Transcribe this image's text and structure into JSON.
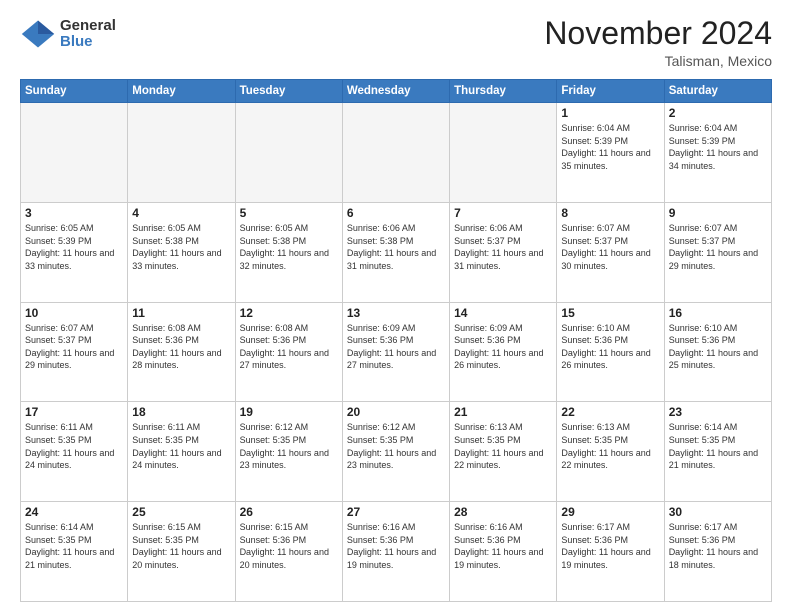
{
  "header": {
    "logo_general": "General",
    "logo_blue": "Blue",
    "month_title": "November 2024",
    "location": "Talisman, Mexico"
  },
  "days_of_week": [
    "Sunday",
    "Monday",
    "Tuesday",
    "Wednesday",
    "Thursday",
    "Friday",
    "Saturday"
  ],
  "weeks": [
    [
      {
        "day": "",
        "empty": true
      },
      {
        "day": "",
        "empty": true
      },
      {
        "day": "",
        "empty": true
      },
      {
        "day": "",
        "empty": true
      },
      {
        "day": "",
        "empty": true
      },
      {
        "day": "1",
        "sunrise": "6:04 AM",
        "sunset": "5:39 PM",
        "daylight": "11 hours and 35 minutes."
      },
      {
        "day": "2",
        "sunrise": "6:04 AM",
        "sunset": "5:39 PM",
        "daylight": "11 hours and 34 minutes."
      }
    ],
    [
      {
        "day": "3",
        "sunrise": "6:05 AM",
        "sunset": "5:39 PM",
        "daylight": "11 hours and 33 minutes."
      },
      {
        "day": "4",
        "sunrise": "6:05 AM",
        "sunset": "5:38 PM",
        "daylight": "11 hours and 33 minutes."
      },
      {
        "day": "5",
        "sunrise": "6:05 AM",
        "sunset": "5:38 PM",
        "daylight": "11 hours and 32 minutes."
      },
      {
        "day": "6",
        "sunrise": "6:06 AM",
        "sunset": "5:38 PM",
        "daylight": "11 hours and 31 minutes."
      },
      {
        "day": "7",
        "sunrise": "6:06 AM",
        "sunset": "5:37 PM",
        "daylight": "11 hours and 31 minutes."
      },
      {
        "day": "8",
        "sunrise": "6:07 AM",
        "sunset": "5:37 PM",
        "daylight": "11 hours and 30 minutes."
      },
      {
        "day": "9",
        "sunrise": "6:07 AM",
        "sunset": "5:37 PM",
        "daylight": "11 hours and 29 minutes."
      }
    ],
    [
      {
        "day": "10",
        "sunrise": "6:07 AM",
        "sunset": "5:37 PM",
        "daylight": "11 hours and 29 minutes."
      },
      {
        "day": "11",
        "sunrise": "6:08 AM",
        "sunset": "5:36 PM",
        "daylight": "11 hours and 28 minutes."
      },
      {
        "day": "12",
        "sunrise": "6:08 AM",
        "sunset": "5:36 PM",
        "daylight": "11 hours and 27 minutes."
      },
      {
        "day": "13",
        "sunrise": "6:09 AM",
        "sunset": "5:36 PM",
        "daylight": "11 hours and 27 minutes."
      },
      {
        "day": "14",
        "sunrise": "6:09 AM",
        "sunset": "5:36 PM",
        "daylight": "11 hours and 26 minutes."
      },
      {
        "day": "15",
        "sunrise": "6:10 AM",
        "sunset": "5:36 PM",
        "daylight": "11 hours and 26 minutes."
      },
      {
        "day": "16",
        "sunrise": "6:10 AM",
        "sunset": "5:36 PM",
        "daylight": "11 hours and 25 minutes."
      }
    ],
    [
      {
        "day": "17",
        "sunrise": "6:11 AM",
        "sunset": "5:35 PM",
        "daylight": "11 hours and 24 minutes."
      },
      {
        "day": "18",
        "sunrise": "6:11 AM",
        "sunset": "5:35 PM",
        "daylight": "11 hours and 24 minutes."
      },
      {
        "day": "19",
        "sunrise": "6:12 AM",
        "sunset": "5:35 PM",
        "daylight": "11 hours and 23 minutes."
      },
      {
        "day": "20",
        "sunrise": "6:12 AM",
        "sunset": "5:35 PM",
        "daylight": "11 hours and 23 minutes."
      },
      {
        "day": "21",
        "sunrise": "6:13 AM",
        "sunset": "5:35 PM",
        "daylight": "11 hours and 22 minutes."
      },
      {
        "day": "22",
        "sunrise": "6:13 AM",
        "sunset": "5:35 PM",
        "daylight": "11 hours and 22 minutes."
      },
      {
        "day": "23",
        "sunrise": "6:14 AM",
        "sunset": "5:35 PM",
        "daylight": "11 hours and 21 minutes."
      }
    ],
    [
      {
        "day": "24",
        "sunrise": "6:14 AM",
        "sunset": "5:35 PM",
        "daylight": "11 hours and 21 minutes."
      },
      {
        "day": "25",
        "sunrise": "6:15 AM",
        "sunset": "5:35 PM",
        "daylight": "11 hours and 20 minutes."
      },
      {
        "day": "26",
        "sunrise": "6:15 AM",
        "sunset": "5:36 PM",
        "daylight": "11 hours and 20 minutes."
      },
      {
        "day": "27",
        "sunrise": "6:16 AM",
        "sunset": "5:36 PM",
        "daylight": "11 hours and 19 minutes."
      },
      {
        "day": "28",
        "sunrise": "6:16 AM",
        "sunset": "5:36 PM",
        "daylight": "11 hours and 19 minutes."
      },
      {
        "day": "29",
        "sunrise": "6:17 AM",
        "sunset": "5:36 PM",
        "daylight": "11 hours and 19 minutes."
      },
      {
        "day": "30",
        "sunrise": "6:17 AM",
        "sunset": "5:36 PM",
        "daylight": "11 hours and 18 minutes."
      }
    ]
  ]
}
